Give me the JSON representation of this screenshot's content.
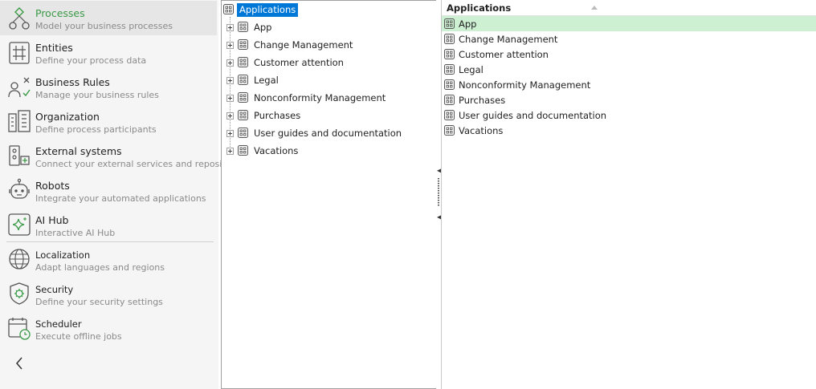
{
  "sidebar": {
    "items": [
      {
        "title": "Processes",
        "subtitle": "Model your business processes",
        "icon": "processes-icon",
        "active": true
      },
      {
        "title": "Entities",
        "subtitle": "Define your process data",
        "icon": "entities-icon"
      },
      {
        "title": "Business Rules",
        "subtitle": "Manage your business rules",
        "icon": "business-rules-icon"
      },
      {
        "title": "Organization",
        "subtitle": "Define process participants",
        "icon": "organization-icon"
      },
      {
        "title": "External systems",
        "subtitle": "Connect your external services and repositories",
        "icon": "external-systems-icon"
      },
      {
        "title": "Robots",
        "subtitle": "Integrate your automated applications",
        "icon": "robot-icon"
      },
      {
        "title": "AI Hub",
        "subtitle": "Interactive AI Hub",
        "icon": "ai-hub-icon"
      }
    ],
    "secondary_items": [
      {
        "title": "Localization",
        "subtitle": "Adapt languages and regions",
        "icon": "globe-icon"
      },
      {
        "title": "Security",
        "subtitle": "Define your security settings",
        "icon": "security-icon"
      },
      {
        "title": "Scheduler",
        "subtitle": "Execute offline jobs",
        "icon": "scheduler-icon"
      }
    ],
    "collapse_icon": "chevron-left-icon"
  },
  "tree": {
    "root_label": "Applications",
    "nodes": [
      "App",
      "Change Management",
      "Customer attention",
      "Legal",
      "Nonconformity Management",
      "Purchases",
      "User guides and documentation",
      "Vacations"
    ]
  },
  "list": {
    "header": "Applications",
    "selected_index": 0,
    "rows": [
      "App",
      "Change Management",
      "Customer attention",
      "Legal",
      "Nonconformity Management",
      "Purchases",
      "User guides and documentation",
      "Vacations"
    ]
  },
  "colors": {
    "accent_green": "#3a9a46",
    "selection_blue": "#0078d7",
    "row_selected": "#cdf0d2"
  }
}
